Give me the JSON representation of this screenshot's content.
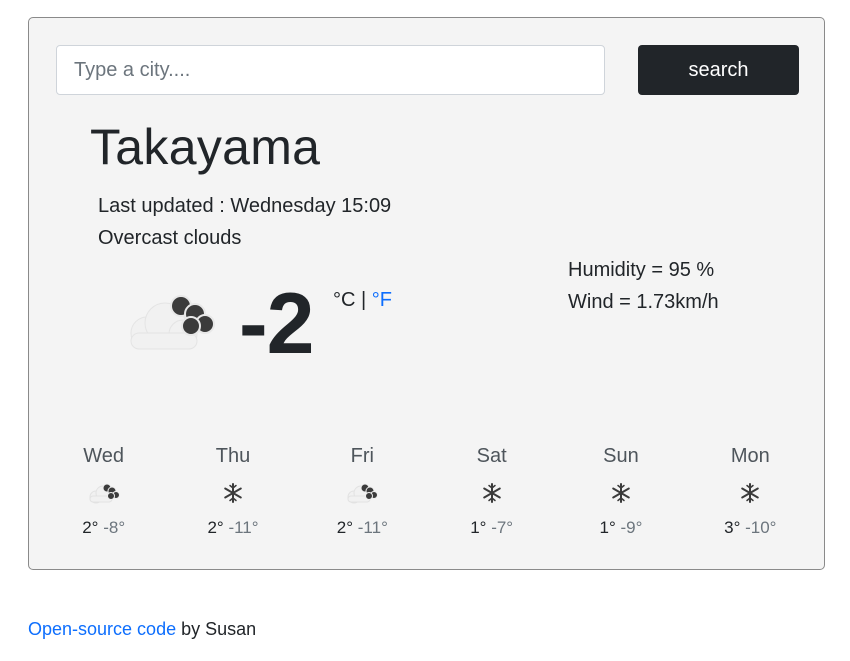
{
  "search": {
    "placeholder": "Type a city....",
    "button_label": "search"
  },
  "current": {
    "city": "Takayama",
    "last_updated": "Last updated : Wednesday 15:09",
    "description": "Overcast clouds",
    "temperature": "-2",
    "unit_celsius": "°C",
    "unit_separator": " | ",
    "unit_fahrenheit": "°F",
    "humidity": "Humidity = 95 %",
    "wind": "Wind = 1.73km/h",
    "icon": "overcast-clouds-icon"
  },
  "forecast": [
    {
      "day": "Wed",
      "high": "2°",
      "low": "-8°",
      "icon": "overcast-clouds-icon"
    },
    {
      "day": "Thu",
      "high": "2°",
      "low": "-11°",
      "icon": "snowflake-icon"
    },
    {
      "day": "Fri",
      "high": "2°",
      "low": "-11°",
      "icon": "overcast-clouds-icon"
    },
    {
      "day": "Sat",
      "high": "1°",
      "low": "-7°",
      "icon": "snowflake-icon"
    },
    {
      "day": "Sun",
      "high": "1°",
      "low": "-9°",
      "icon": "snowflake-icon"
    },
    {
      "day": "Mon",
      "high": "3°",
      "low": "-10°",
      "icon": "snowflake-icon"
    }
  ],
  "footer": {
    "link_text": "Open-source code",
    "suffix": " by Susan"
  },
  "colors": {
    "link": "#0d6efd",
    "button_bg": "#212529",
    "card_bg": "#f4f4f4"
  }
}
